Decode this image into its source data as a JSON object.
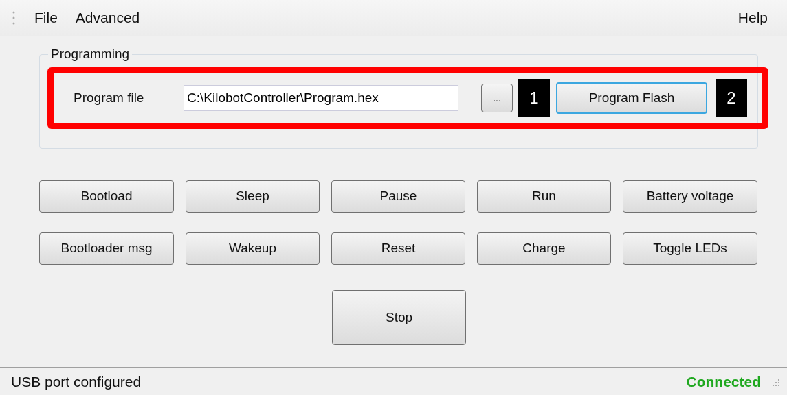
{
  "menu": {
    "left": [
      "File",
      "Advanced"
    ],
    "right": [
      "Help"
    ]
  },
  "programming": {
    "title": "Programming",
    "label": "Program file",
    "value": "C:\\KilobotController\\Program.hex",
    "browse": "...",
    "flash": {
      "label": "Program Flash",
      "focused": true
    }
  },
  "callouts": [
    "1",
    "2"
  ],
  "buttons": [
    [
      "Bootload",
      "Sleep",
      "Pause",
      "Run",
      "Battery voltage"
    ],
    [
      "Bootloader msg",
      "Wakeup",
      "Reset",
      "Charge",
      "Toggle LEDs"
    ]
  ],
  "stop": "Stop",
  "status_bar": {
    "message": "USB port configured",
    "connection": "Connected"
  }
}
